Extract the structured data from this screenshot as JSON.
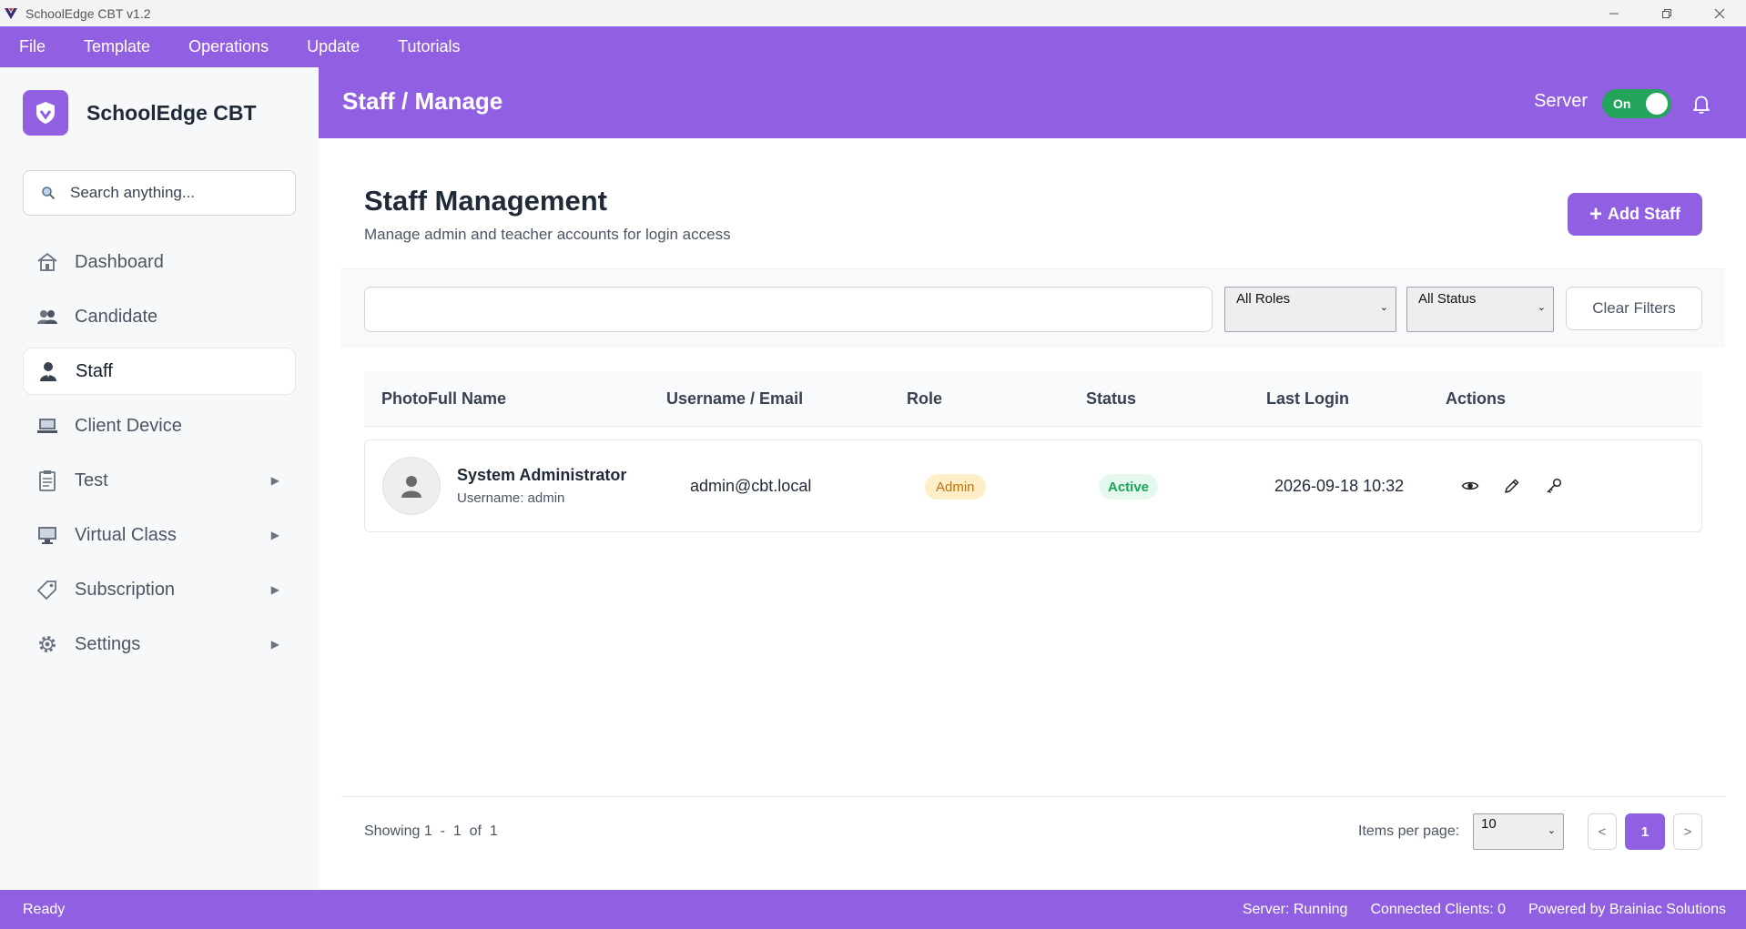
{
  "window": {
    "title": "SchoolEdge CBT v1.2"
  },
  "menu": [
    "File",
    "Template",
    "Operations",
    "Update",
    "Tutorials"
  ],
  "sidebar": {
    "brand": "SchoolEdge CBT",
    "search_placeholder": "Search anything...",
    "items": [
      {
        "label": "Dashboard",
        "icon": "house-icon",
        "active": false,
        "submenu": false
      },
      {
        "label": "Candidate",
        "icon": "users-icon",
        "active": false,
        "submenu": false
      },
      {
        "label": "Staff",
        "icon": "staff-icon",
        "active": true,
        "submenu": false
      },
      {
        "label": "Client Device",
        "icon": "laptop-icon",
        "active": false,
        "submenu": false
      },
      {
        "label": "Test",
        "icon": "clipboard-icon",
        "active": false,
        "submenu": true
      },
      {
        "label": "Virtual Class",
        "icon": "monitor-icon",
        "active": false,
        "submenu": true
      },
      {
        "label": "Subscription",
        "icon": "tag-icon",
        "active": false,
        "submenu": true
      },
      {
        "label": "Settings",
        "icon": "gear-icon",
        "active": false,
        "submenu": true
      }
    ],
    "arrow": "▶"
  },
  "header": {
    "breadcrumb": "Staff / Manage",
    "server_label": "Server",
    "server_toggle": "On"
  },
  "main": {
    "title": "Staff Management",
    "subtitle": "Manage admin and teacher accounts for login access",
    "add_button": "Add Staff",
    "add_button_icon": "+",
    "filters": {
      "search_value": "",
      "roles_selected": "All Roles",
      "status_selected": "All Status",
      "clear_label": "Clear Filters"
    },
    "table": {
      "columns": [
        "PhotoFull Name",
        "Username / Email",
        "Role",
        "Status",
        "Last Login",
        "Actions"
      ],
      "rows": [
        {
          "name": "System Administrator",
          "username": "Username: admin",
          "email": "admin@cbt.local",
          "role": "Admin",
          "status": "Active",
          "last_login": "2026-09-18 10:32"
        }
      ]
    },
    "pagination": {
      "showing": "Showing 1  -  1  of  1",
      "items_per_page_label": "Items per page:",
      "items_per_page": "10",
      "prev": "<",
      "current": "1",
      "next": ">"
    }
  },
  "statusbar": {
    "left": "Ready",
    "server": "Server: Running",
    "clients": "Connected Clients: 0",
    "powered": "Powered by Brainiac Solutions"
  },
  "colors": {
    "accent": "#915fe1",
    "toggle_on": "#22a55b",
    "admin_badge_bg": "#fdf0c8",
    "active_badge_bg": "#e5f8ee"
  }
}
